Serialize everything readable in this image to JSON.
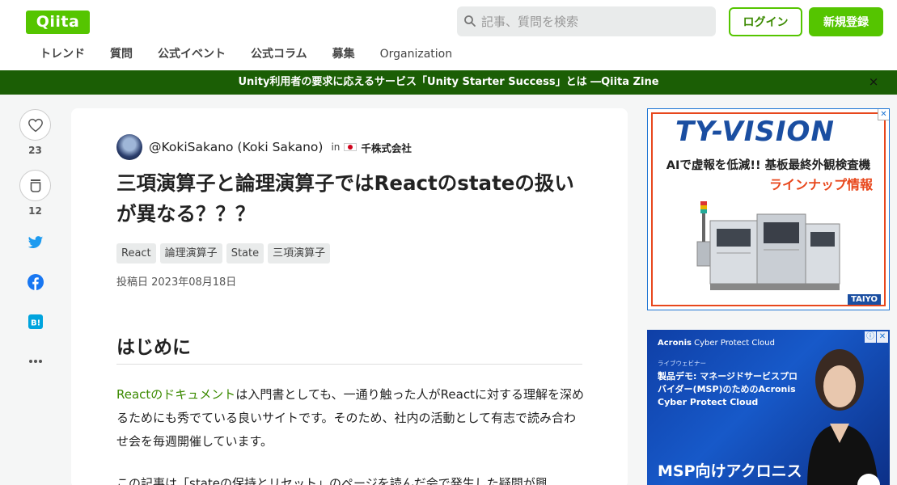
{
  "header": {
    "logo": "Qiita",
    "search_placeholder": "記事、質問を検索",
    "login_label": "ログイン",
    "signup_label": "新規登録",
    "nav": [
      "トレンド",
      "質問",
      "公式イベント",
      "公式コラム",
      "募集",
      "Organization"
    ]
  },
  "banner": {
    "text": "Unity利用者の要求に応えるサービス「Unity Starter Success」とは ―Qiita Zine",
    "close": "×"
  },
  "actions": {
    "like_count": "23",
    "stock_count": "12"
  },
  "article": {
    "author": "@KokiSakano (Koki Sakano)",
    "in_text": "in",
    "organization": "千株式会社",
    "title": "三項演算子と論理演算子ではReactのstateの扱いが異なる？？？",
    "tags": [
      "React",
      "論理演算子",
      "State",
      "三項演算子"
    ],
    "posted": "投稿日 2023年08月18日",
    "h2": "はじめに",
    "para_link": "Reactのドキュメント",
    "para_rest": "は入門書としても、一通り触った人がReactに対する理解を深めるためにも秀でている良いサイトです。そのため、社内の活動として有志で読み合わせ会を毎週開催しています。",
    "para2": "この記事は「stateの保持とリセット」のページを読んだ会で発生した疑問が興"
  },
  "ad1": {
    "logo": "TY-VISION",
    "line1": "AIで虚報を低減!! 基板最終外観検査機",
    "line2": "ラインナップ情報",
    "brand": "TAIYO",
    "badge": "✕"
  },
  "ad2": {
    "brand_bold": "Acronis",
    "brand_rest": " Cyber Protect Cloud",
    "small": "ライブウェビナー",
    "main": "製品デモ: マネージドサービスプロバイダー(MSP)のためのAcronis Cyber Protect Cloud",
    "bottom": "MSP向けアクロニス",
    "icon_info": "ⓘ",
    "icon_close": "✕"
  }
}
